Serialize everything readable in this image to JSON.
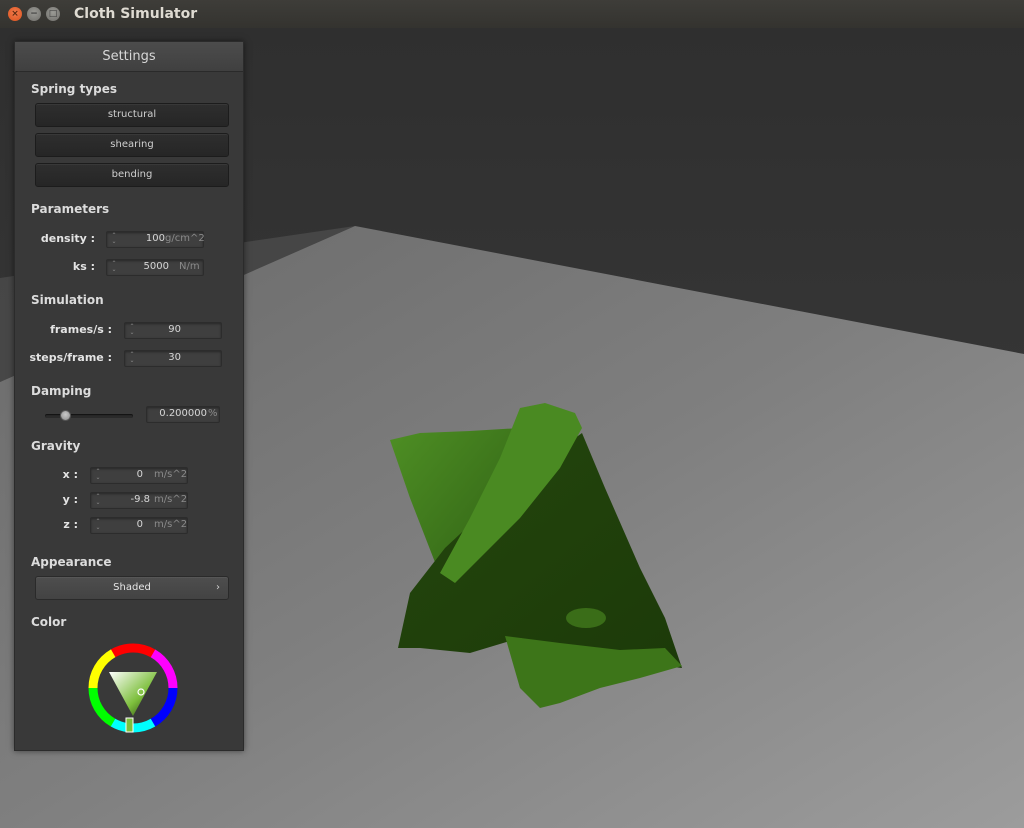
{
  "window": {
    "title": "Cloth Simulator",
    "controls": [
      "close-icon",
      "minimize-icon",
      "maximize-icon"
    ]
  },
  "settings": {
    "header": "Settings",
    "spring_types": {
      "label": "Spring types",
      "buttons": [
        "structural",
        "shearing",
        "bending"
      ]
    },
    "parameters": {
      "label": "Parameters",
      "density": {
        "label": "density :",
        "value": "100",
        "unit": "g/cm^2"
      },
      "ks": {
        "label": "ks :",
        "value": "5000",
        "unit": "N/m"
      }
    },
    "simulation": {
      "label": "Simulation",
      "frames_per_s": {
        "label": "frames/s :",
        "value": "90"
      },
      "steps_per_frame": {
        "label": "steps/frame :",
        "value": "30"
      }
    },
    "damping": {
      "label": "Damping",
      "value": "0.200000",
      "unit": "%",
      "slider_fraction": 0.2
    },
    "gravity": {
      "label": "Gravity",
      "x": {
        "label": "x :",
        "value": "0",
        "unit": "m/s^2"
      },
      "y": {
        "label": "y :",
        "value": "-9.8",
        "unit": "m/s^2"
      },
      "z": {
        "label": "z :",
        "value": "0",
        "unit": "m/s^2"
      }
    },
    "appearance": {
      "label": "Appearance",
      "selected": "Shaded"
    },
    "color": {
      "label": "Color",
      "selected_hex": "#3a6b1a"
    }
  },
  "scene": {
    "cloth_color": "#3f7a1e",
    "floor_color": "#8c8c8c",
    "background_color": "#353535"
  }
}
